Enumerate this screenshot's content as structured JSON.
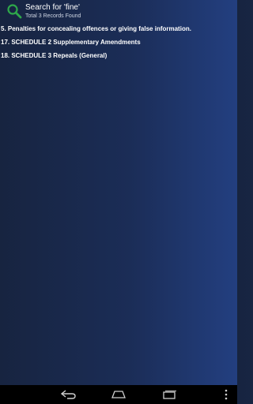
{
  "header": {
    "title": "Search for 'fine'",
    "subtitle": "Total 3 Records Found",
    "icon": "search-icon",
    "icon_color": "#2ea84a"
  },
  "results": [
    {
      "label": "5. Penalties for concealing offences or giving false information."
    },
    {
      "label": "17. SCHEDULE 2 Supplementary Amendments"
    },
    {
      "label": "18. SCHEDULE 3 Repeals (General)"
    }
  ],
  "nav_bar": {
    "buttons": [
      "back-icon",
      "home-icon",
      "recent-apps-icon",
      "overflow-menu-icon"
    ]
  }
}
